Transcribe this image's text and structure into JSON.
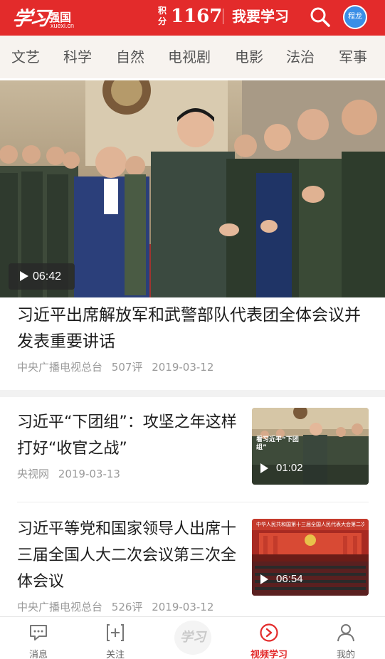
{
  "header": {
    "logo_script": "学习",
    "logo_name": "强国",
    "logo_domain": "xuexi.cn",
    "points_label": "积分",
    "points_value": "1167",
    "study_button": "我要学习",
    "avatar_text": "程龙",
    "accent_color": "#e32b2b"
  },
  "tabs": [
    "文艺",
    "科学",
    "自然",
    "电视剧",
    "电影",
    "法治",
    "军事"
  ],
  "featured": {
    "duration": "06:42",
    "title": "习近平出席解放军和武警部队代表团全体会议并发表重要讲话",
    "source": "中央广播电视总台",
    "comments": "507评",
    "date": "2019-03-12"
  },
  "items": [
    {
      "title": "习近平“下团组”：攻坚之年这样打好“收官之战”",
      "source": "央视网",
      "comments": "",
      "date": "2019-03-13",
      "duration": "01:02",
      "thumb_caption": "看习近平“下团组”"
    },
    {
      "title": "习近平等党和国家领导人出席十三届全国人大二次会议第三次全体会议",
      "source": "中央广播电视总台",
      "comments": "526评",
      "date": "2019-03-12",
      "duration": "06:54",
      "thumb_caption": "中华人民共和国第十三届全国人民代表大会第二次会议"
    }
  ],
  "bottom_nav": [
    {
      "label": "消息",
      "icon": "message-icon",
      "active": false
    },
    {
      "label": "关注",
      "icon": "follow-icon",
      "active": false
    },
    {
      "label": "",
      "icon": "xuexi-logo-icon",
      "active": false
    },
    {
      "label": "视频学习",
      "icon": "video-study-icon",
      "active": true
    },
    {
      "label": "我的",
      "icon": "profile-icon",
      "active": false
    }
  ],
  "bottom_center_logo": "学习"
}
